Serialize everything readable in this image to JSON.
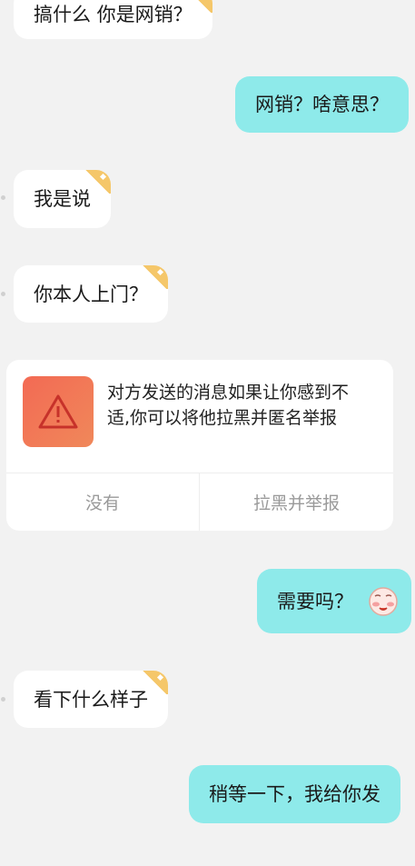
{
  "messages": [
    {
      "side": "left",
      "text": "搞什么 你是网销？",
      "tagged": true
    },
    {
      "side": "right",
      "text": "网销？啥意思？"
    },
    {
      "side": "left",
      "text": "我是说",
      "tagged": true
    },
    {
      "side": "left",
      "text": "你本人上门？",
      "tagged": true
    },
    {
      "side": "right",
      "text": "需要吗？",
      "emoji": "blushing-face-emoji"
    },
    {
      "side": "left",
      "text": "看下什么样子",
      "tagged": true
    },
    {
      "side": "right",
      "text": "稍等一下，我给你发"
    }
  ],
  "report_card": {
    "icon": "warning-icon",
    "text": "对方发送的消息如果让你感到不适,你可以将他拉黑并匿名举报",
    "dismiss_label": "没有",
    "report_label": "拉黑并举报"
  },
  "colors": {
    "background": "#f2f2f2",
    "incoming_bubble": "#ffffff",
    "outgoing_bubble": "#8eeaea",
    "tag": "#f5c76a",
    "warning": "#f36a54"
  }
}
